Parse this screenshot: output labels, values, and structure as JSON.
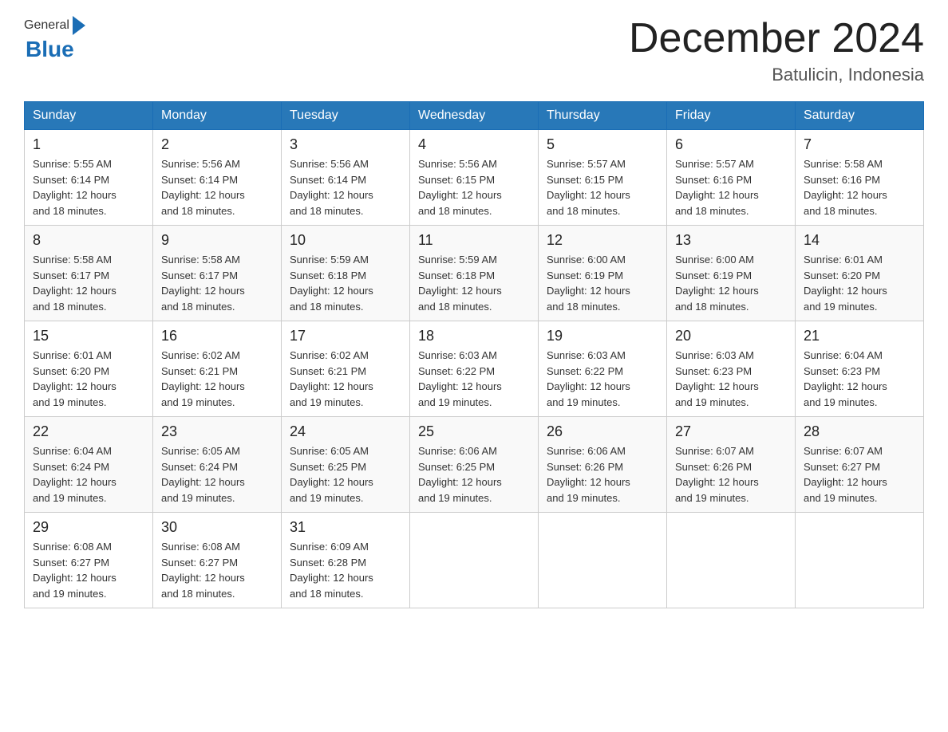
{
  "header": {
    "logo_text_general": "General",
    "logo_text_blue": "Blue",
    "month_title": "December 2024",
    "location": "Batulicin, Indonesia"
  },
  "days_of_week": [
    "Sunday",
    "Monday",
    "Tuesday",
    "Wednesday",
    "Thursday",
    "Friday",
    "Saturday"
  ],
  "weeks": [
    [
      {
        "day": "1",
        "sunrise": "5:55 AM",
        "sunset": "6:14 PM",
        "daylight": "12 hours and 18 minutes."
      },
      {
        "day": "2",
        "sunrise": "5:56 AM",
        "sunset": "6:14 PM",
        "daylight": "12 hours and 18 minutes."
      },
      {
        "day": "3",
        "sunrise": "5:56 AM",
        "sunset": "6:14 PM",
        "daylight": "12 hours and 18 minutes."
      },
      {
        "day": "4",
        "sunrise": "5:56 AM",
        "sunset": "6:15 PM",
        "daylight": "12 hours and 18 minutes."
      },
      {
        "day": "5",
        "sunrise": "5:57 AM",
        "sunset": "6:15 PM",
        "daylight": "12 hours and 18 minutes."
      },
      {
        "day": "6",
        "sunrise": "5:57 AM",
        "sunset": "6:16 PM",
        "daylight": "12 hours and 18 minutes."
      },
      {
        "day": "7",
        "sunrise": "5:58 AM",
        "sunset": "6:16 PM",
        "daylight": "12 hours and 18 minutes."
      }
    ],
    [
      {
        "day": "8",
        "sunrise": "5:58 AM",
        "sunset": "6:17 PM",
        "daylight": "12 hours and 18 minutes."
      },
      {
        "day": "9",
        "sunrise": "5:58 AM",
        "sunset": "6:17 PM",
        "daylight": "12 hours and 18 minutes."
      },
      {
        "day": "10",
        "sunrise": "5:59 AM",
        "sunset": "6:18 PM",
        "daylight": "12 hours and 18 minutes."
      },
      {
        "day": "11",
        "sunrise": "5:59 AM",
        "sunset": "6:18 PM",
        "daylight": "12 hours and 18 minutes."
      },
      {
        "day": "12",
        "sunrise": "6:00 AM",
        "sunset": "6:19 PM",
        "daylight": "12 hours and 18 minutes."
      },
      {
        "day": "13",
        "sunrise": "6:00 AM",
        "sunset": "6:19 PM",
        "daylight": "12 hours and 18 minutes."
      },
      {
        "day": "14",
        "sunrise": "6:01 AM",
        "sunset": "6:20 PM",
        "daylight": "12 hours and 19 minutes."
      }
    ],
    [
      {
        "day": "15",
        "sunrise": "6:01 AM",
        "sunset": "6:20 PM",
        "daylight": "12 hours and 19 minutes."
      },
      {
        "day": "16",
        "sunrise": "6:02 AM",
        "sunset": "6:21 PM",
        "daylight": "12 hours and 19 minutes."
      },
      {
        "day": "17",
        "sunrise": "6:02 AM",
        "sunset": "6:21 PM",
        "daylight": "12 hours and 19 minutes."
      },
      {
        "day": "18",
        "sunrise": "6:03 AM",
        "sunset": "6:22 PM",
        "daylight": "12 hours and 19 minutes."
      },
      {
        "day": "19",
        "sunrise": "6:03 AM",
        "sunset": "6:22 PM",
        "daylight": "12 hours and 19 minutes."
      },
      {
        "day": "20",
        "sunrise": "6:03 AM",
        "sunset": "6:23 PM",
        "daylight": "12 hours and 19 minutes."
      },
      {
        "day": "21",
        "sunrise": "6:04 AM",
        "sunset": "6:23 PM",
        "daylight": "12 hours and 19 minutes."
      }
    ],
    [
      {
        "day": "22",
        "sunrise": "6:04 AM",
        "sunset": "6:24 PM",
        "daylight": "12 hours and 19 minutes."
      },
      {
        "day": "23",
        "sunrise": "6:05 AM",
        "sunset": "6:24 PM",
        "daylight": "12 hours and 19 minutes."
      },
      {
        "day": "24",
        "sunrise": "6:05 AM",
        "sunset": "6:25 PM",
        "daylight": "12 hours and 19 minutes."
      },
      {
        "day": "25",
        "sunrise": "6:06 AM",
        "sunset": "6:25 PM",
        "daylight": "12 hours and 19 minutes."
      },
      {
        "day": "26",
        "sunrise": "6:06 AM",
        "sunset": "6:26 PM",
        "daylight": "12 hours and 19 minutes."
      },
      {
        "day": "27",
        "sunrise": "6:07 AM",
        "sunset": "6:26 PM",
        "daylight": "12 hours and 19 minutes."
      },
      {
        "day": "28",
        "sunrise": "6:07 AM",
        "sunset": "6:27 PM",
        "daylight": "12 hours and 19 minutes."
      }
    ],
    [
      {
        "day": "29",
        "sunrise": "6:08 AM",
        "sunset": "6:27 PM",
        "daylight": "12 hours and 19 minutes."
      },
      {
        "day": "30",
        "sunrise": "6:08 AM",
        "sunset": "6:27 PM",
        "daylight": "12 hours and 18 minutes."
      },
      {
        "day": "31",
        "sunrise": "6:09 AM",
        "sunset": "6:28 PM",
        "daylight": "12 hours and 18 minutes."
      },
      null,
      null,
      null,
      null
    ]
  ],
  "labels": {
    "sunrise": "Sunrise: ",
    "sunset": "Sunset: ",
    "daylight": "Daylight: "
  }
}
